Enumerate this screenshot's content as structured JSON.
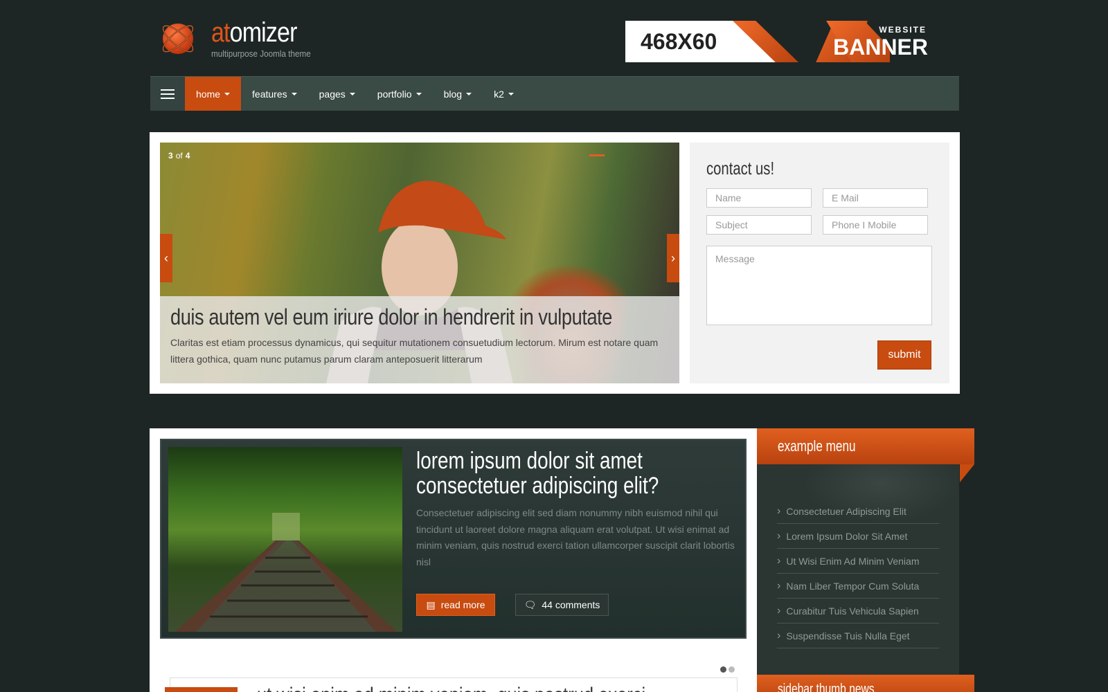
{
  "header": {
    "logo_accent": "at",
    "logo_rest": "omizer",
    "tagline": "multipurpose Joomla theme",
    "banner_size": "468X60",
    "banner_small": "WEBSITE",
    "banner_big": "BANNER"
  },
  "nav": {
    "items": [
      {
        "label": "home",
        "active": true
      },
      {
        "label": "features"
      },
      {
        "label": "pages"
      },
      {
        "label": "portfolio"
      },
      {
        "label": "blog"
      },
      {
        "label": "k2"
      }
    ]
  },
  "slider": {
    "current": "3",
    "of": "of",
    "total": "4",
    "title": "duis autem vel eum iriure dolor in hendrerit in vulputate",
    "text": "Claritas est etiam processus dynamicus, qui sequitur mutationem consuetudium lectorum. Mirum est notare quam littera gothica, quam nunc putamus parum claram anteposuerit litterarum"
  },
  "contact": {
    "title": "contact us!",
    "name_placeholder": "Name",
    "email_placeholder": "E Mail",
    "subject_placeholder": "Subject",
    "phone_placeholder": "Phone I Mobile",
    "message_placeholder": "Message",
    "submit_label": "submit"
  },
  "featured": {
    "title": "lorem ipsum dolor sit amet consectetuer adipiscing elit?",
    "text": "Consectetuer adipiscing elit sed diam nonummy nibh euismod nihil qui tincidunt ut laoreet dolore magna aliquam erat volutpat. Ut wisi enimat ad minim veniam, quis nostrud exerci tation ullamcorper suscipit clarit lobortis nisl",
    "read_more_label": "read more",
    "comments_label": "44 comments"
  },
  "next_article": {
    "title": "ut wisi enim ad minim veniam, quis nostrud exerci"
  },
  "sidebar": {
    "menu_title": "example menu",
    "items": [
      "Consectetuer Adipiscing Elit",
      "Lorem Ipsum Dolor Sit Amet",
      "Ut Wisi Enim Ad Minim Veniam",
      "Nam Liber Tempor Cum Soluta",
      "Curabitur Tuis Vehicula Sapien",
      "Suspendisse Tuis Nulla Eget"
    ],
    "thumb_news_title": "sidebar thumb news"
  },
  "colors": {
    "accent": "#c84b10",
    "background": "#1d2624",
    "nav": "#3a4a45"
  }
}
